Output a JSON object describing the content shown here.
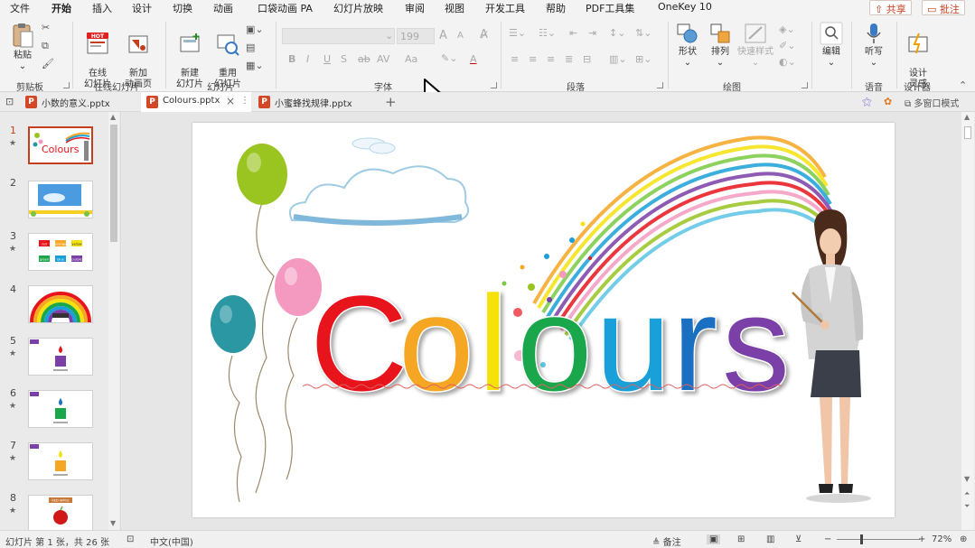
{
  "menu": {
    "tabs": [
      "文件",
      "开始",
      "插入",
      "设计",
      "切换",
      "动画",
      "口袋动画 PA",
      "幻灯片放映",
      "审阅",
      "视图",
      "开发工具",
      "帮助",
      "PDF工具集",
      "OneKey 10"
    ],
    "share": "共享",
    "comment": "批注"
  },
  "ribbon": {
    "clipboard": {
      "paste": "粘贴",
      "group": "剪贴板"
    },
    "online": {
      "online_slide": "在线\n幻灯片",
      "new_anim": "新加\n动画页",
      "hot": "HOT",
      "group": "在线幻灯片"
    },
    "slides": {
      "new_slide": "新建\n幻灯片",
      "reuse": "重用\n幻灯片",
      "group": "幻灯片"
    },
    "font": {
      "size": "199",
      "bold": "B",
      "italic": "I",
      "underline": "U",
      "shadow": "S",
      "strike": "ab",
      "spacing": "AV",
      "case": "Aa",
      "color": "A",
      "grow": "A",
      "shrink": "A",
      "group": "字体"
    },
    "paragraph": {
      "group": "段落"
    },
    "drawing": {
      "shape": "形状",
      "arrange": "排列",
      "quick_style": "快速样式",
      "group": "绘图"
    },
    "editing": {
      "edit": "编辑"
    },
    "voice": {
      "dictate": "听写",
      "group": "语音"
    },
    "designer": {
      "design": "设计\n灵感",
      "group": "设计器"
    }
  },
  "doc_tabs": [
    {
      "name": "小数的意义.pptx"
    },
    {
      "name": "Colours.pptx"
    },
    {
      "name": "小蜜蜂找规律.pptx"
    }
  ],
  "window_mode": "多窗口模式",
  "thumbnails": [
    {
      "num": "1",
      "star": "★"
    },
    {
      "num": "2",
      "star": ""
    },
    {
      "num": "3",
      "star": "★"
    },
    {
      "num": "4",
      "star": ""
    },
    {
      "num": "5",
      "star": "★"
    },
    {
      "num": "6",
      "star": "★"
    },
    {
      "num": "7",
      "star": "★"
    },
    {
      "num": "8",
      "star": "★"
    }
  ],
  "slide": {
    "title_letters": [
      {
        "ch": "C",
        "color": "#e8141c"
      },
      {
        "ch": "o",
        "color": "#f5a623"
      },
      {
        "ch": "l",
        "color": "#f5e20a"
      },
      {
        "ch": "o",
        "color": "#1aa64a"
      },
      {
        "ch": "u",
        "color": "#1aa0d8"
      },
      {
        "ch": "r",
        "color": "#1b6fc0"
      },
      {
        "ch": "s",
        "color": "#7b3fa8"
      }
    ],
    "balloons": [
      {
        "color": "#9ac420"
      },
      {
        "color": "#f49ac0"
      },
      {
        "color": "#2a97a2"
      }
    ]
  },
  "thumb_texts": {
    "t1": "Colours",
    "t3": [
      "red",
      "orange",
      "yellow",
      "green",
      "blue",
      "purple"
    ],
    "t8": "RED APPLE"
  },
  "status": {
    "slide_info": "幻灯片 第 1 张，共 26 张",
    "language": "中文(中国)",
    "notes": "备注",
    "zoom": "72%"
  }
}
